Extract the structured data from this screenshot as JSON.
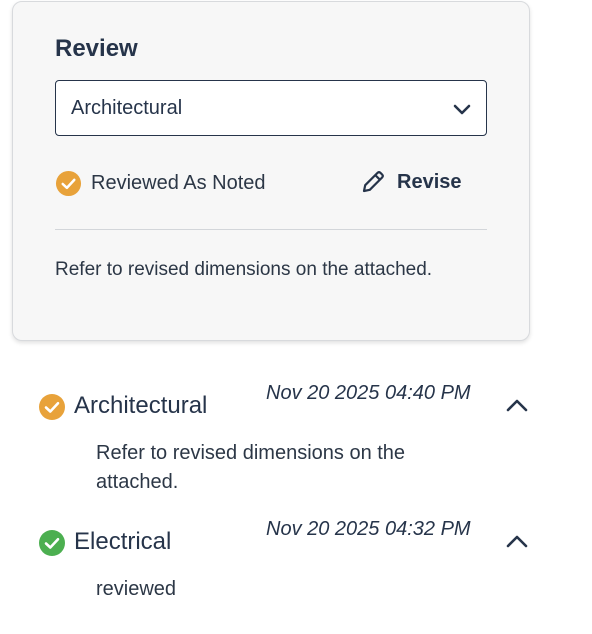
{
  "review_card": {
    "title": "Review",
    "discipline_select": {
      "value": "Architectural"
    },
    "status": {
      "label": "Reviewed As Noted",
      "color": "#e8a23a"
    },
    "revise_label": "Revise",
    "note": "Refer to revised dimensions on the attached."
  },
  "history": [
    {
      "discipline": "Architectural",
      "date": "Nov 20 2025 04:40 PM",
      "note": "Refer to revised dimensions on the attached.",
      "status_color": "#e8a23a",
      "expanded": true
    },
    {
      "discipline": "Electrical",
      "date": "Nov 20 2025 04:32 PM",
      "note": "reviewed",
      "status_color": "#4caf50",
      "expanded": true
    }
  ]
}
